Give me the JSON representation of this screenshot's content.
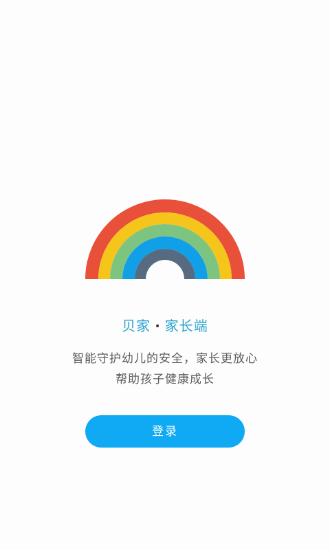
{
  "rainbow": {
    "colors": [
      "#e8503a",
      "#f5c51c",
      "#7cc47f",
      "#119fe8",
      "#566a80"
    ]
  },
  "title": {
    "brand": "贝家",
    "separator": "·",
    "role": "家长端"
  },
  "tagline": {
    "line1": "智能守护幼儿的安全，家长更放心",
    "line2": "帮助孩子健康成长"
  },
  "login": {
    "label": "登录"
  }
}
